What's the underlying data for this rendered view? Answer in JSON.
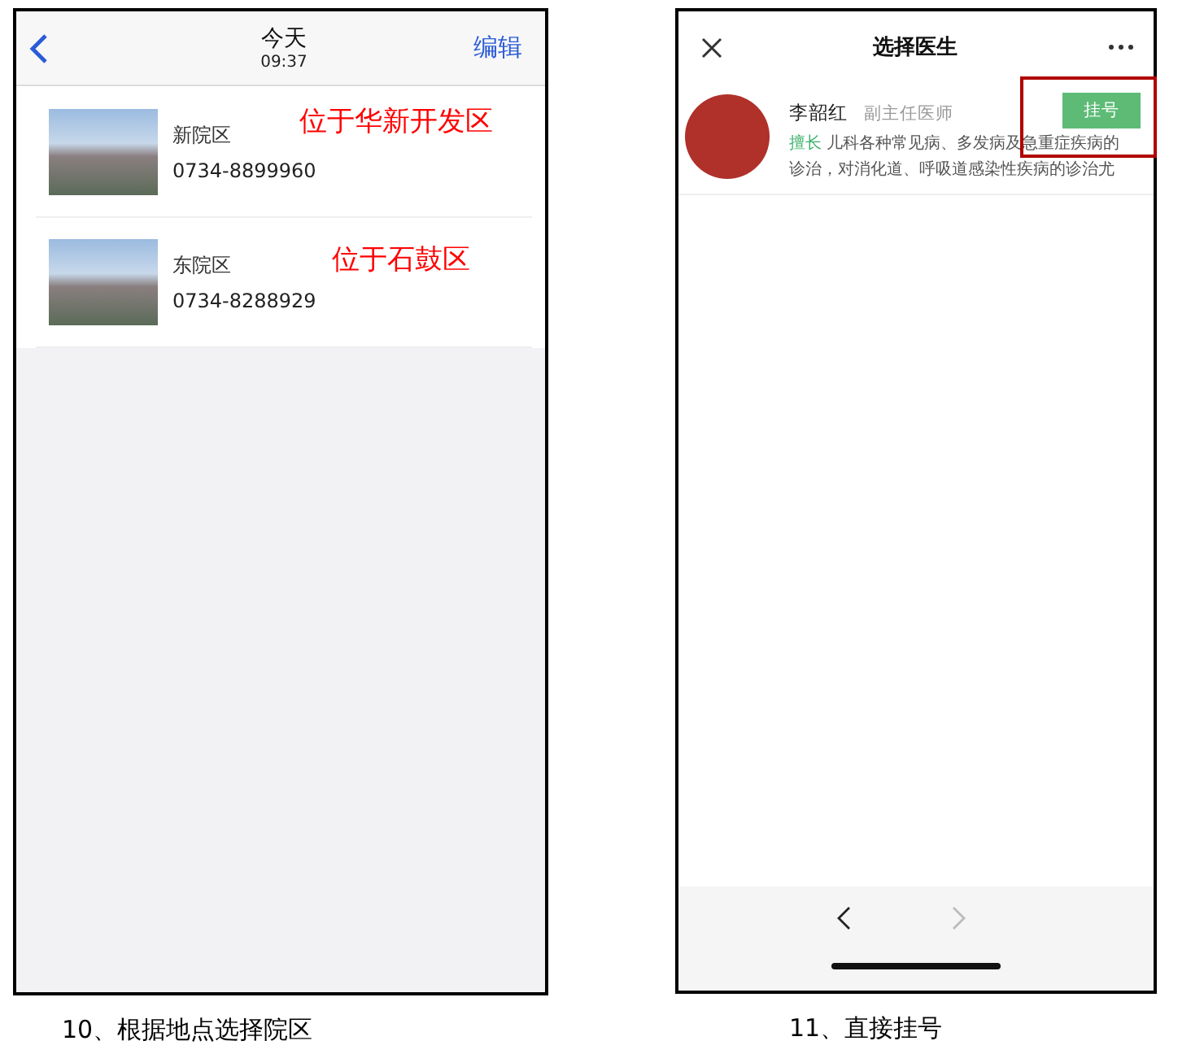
{
  "figures": [
    {
      "kind": "campus_list",
      "header": {
        "title": "今天",
        "subtitle": "09:37",
        "action": "编辑"
      },
      "campuses": [
        {
          "name": "新院区",
          "phone": "0734-8899960",
          "note": "位于华新开发区"
        },
        {
          "name": "东院区",
          "phone": "0734-8288929",
          "note": "位于石鼓区"
        }
      ],
      "caption": "10、根据地点选择院区"
    },
    {
      "kind": "doctor_list",
      "header": {
        "title": "选择医生"
      },
      "doctors": [
        {
          "name": "李韶红",
          "position": "副主任医师",
          "specialty_label": "擅长",
          "specialty": "儿科各种常见病、多发病及急重症疾病的诊治，对消化道、呼吸道感染性疾病的诊治尤",
          "button": "挂号",
          "highlighted": true
        }
      ],
      "nav": {
        "back_enabled": true,
        "forward_enabled": false
      },
      "caption": "11、直接挂号"
    }
  ]
}
